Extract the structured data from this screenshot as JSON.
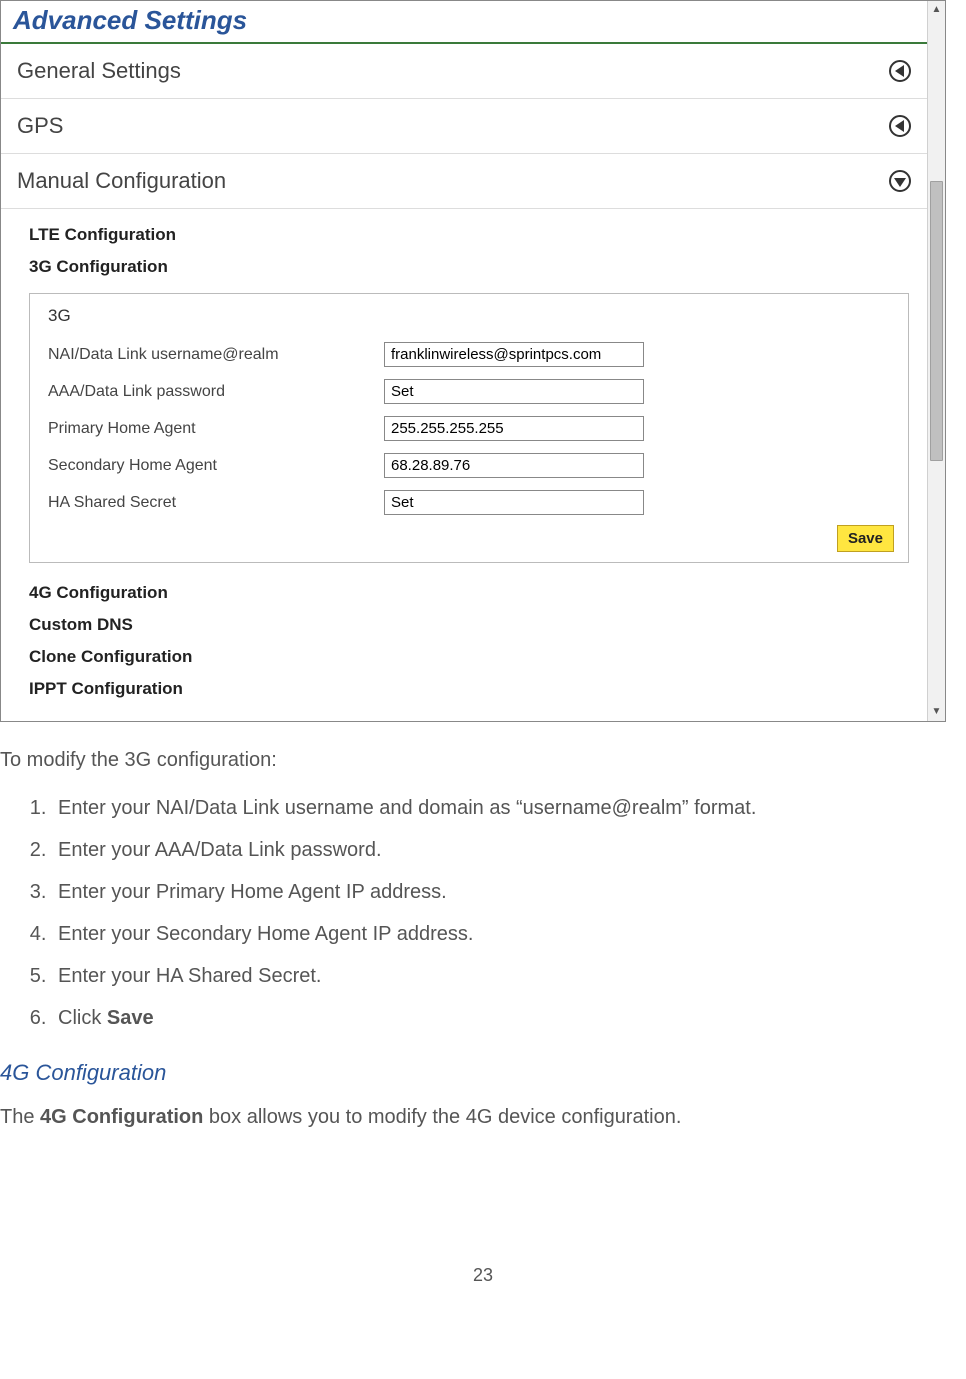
{
  "settings": {
    "title": "Advanced Settings",
    "rows": {
      "general": "General Settings",
      "gps": "GPS",
      "manual": "Manual Configuration"
    },
    "config_links_top": {
      "lte": "LTE Configuration",
      "g3": "3G Configuration"
    },
    "form": {
      "title": "3G",
      "fields": {
        "nai": {
          "label": "NAI/Data Link username@realm",
          "value": "franklinwireless@sprintpcs.com"
        },
        "aaa": {
          "label": "AAA/Data Link password",
          "value": "Set"
        },
        "pha": {
          "label": "Primary Home Agent",
          "value": "255.255.255.255"
        },
        "sha": {
          "label": "Secondary Home Agent",
          "value": "68.28.89.76"
        },
        "hashared": {
          "label": "HA Shared Secret",
          "value": "Set"
        }
      },
      "save_label": "Save"
    },
    "config_links_bottom": {
      "g4": "4G Configuration",
      "dns": "Custom DNS",
      "clone": "Clone Configuration",
      "ippt": "IPPT Configuration"
    }
  },
  "document": {
    "intro": "To modify the 3G configuration:",
    "steps": [
      "Enter your NAI/Data Link username and domain as “username@realm” format.",
      "Enter your AAA/Data Link password.",
      "Enter your Primary Home Agent IP address.",
      "Enter your Secondary Home Agent IP address.",
      "Enter your HA Shared Secret."
    ],
    "step6_prefix": "Click ",
    "step6_bold": "Save",
    "subheading": "4G Configuration",
    "para_prefix": "The ",
    "para_bold": "4G Configuration",
    "para_suffix": " box allows you to modify the 4G device configuration.",
    "page_number": "23"
  }
}
